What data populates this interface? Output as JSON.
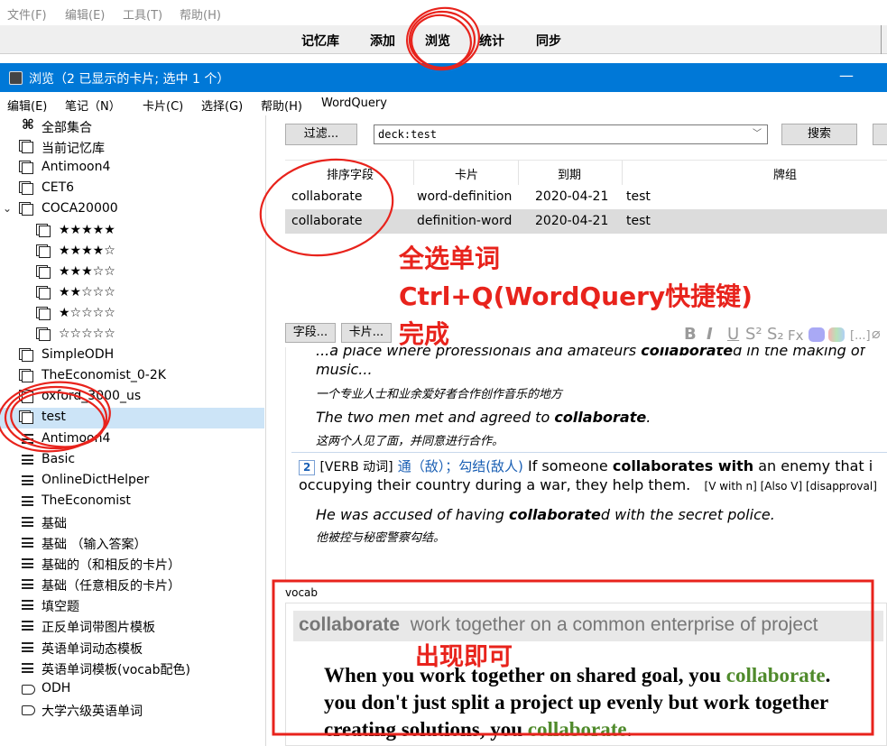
{
  "main_window": {
    "menu": [
      "文件(F)",
      "编辑(E)",
      "工具(T)",
      "帮助(H)"
    ],
    "toolbar": [
      "记忆库",
      "添加",
      "浏览",
      "统计",
      "同步"
    ]
  },
  "browse_window": {
    "title": "浏览（2 已显示的卡片; 选中 1 个）",
    "minimize_glyph": "—",
    "menu": [
      "编辑(E)",
      "笔记（N）",
      "卡片(C)",
      "选择(G)",
      "帮助(H)",
      "WordQuery"
    ]
  },
  "sidebar": {
    "items": [
      {
        "label": "全部集合",
        "icon": "all-collection-icon",
        "indent": 0
      },
      {
        "label": "当前记忆库",
        "icon": "deck-icon",
        "indent": 0
      },
      {
        "label": "Antimoon4",
        "icon": "deck-icon",
        "indent": 0
      },
      {
        "label": "CET6",
        "icon": "deck-icon",
        "indent": 0
      },
      {
        "label": "COCA20000",
        "icon": "deck-icon",
        "indent": 0,
        "expanded": true
      },
      {
        "label": "★★★★★",
        "icon": "deck-icon",
        "indent": 1
      },
      {
        "label": "★★★★☆",
        "icon": "deck-icon",
        "indent": 1
      },
      {
        "label": "★★★☆☆",
        "icon": "deck-icon",
        "indent": 1
      },
      {
        "label": "★★☆☆☆",
        "icon": "deck-icon",
        "indent": 1
      },
      {
        "label": "★☆☆☆☆",
        "icon": "deck-icon",
        "indent": 1
      },
      {
        "label": "☆☆☆☆☆",
        "icon": "deck-icon",
        "indent": 1
      },
      {
        "label": "SimpleODH",
        "icon": "deck-icon",
        "indent": 0
      },
      {
        "label": "TheEconomist_0-2K",
        "icon": "deck-icon",
        "indent": 0
      },
      {
        "label": "oxford_3000_us",
        "icon": "deck-icon",
        "indent": 0
      },
      {
        "label": "test",
        "icon": "deck-icon",
        "indent": 0,
        "selected": true
      },
      {
        "label": "Antimoon4",
        "icon": "note-type-icon",
        "indent": 0
      },
      {
        "label": "Basic",
        "icon": "note-type-icon",
        "indent": 0
      },
      {
        "label": "OnlineDictHelper",
        "icon": "note-type-icon",
        "indent": 0
      },
      {
        "label": "TheEconomist",
        "icon": "note-type-icon",
        "indent": 0
      },
      {
        "label": "基础",
        "icon": "note-type-icon",
        "indent": 0
      },
      {
        "label": "基础 （输入答案）",
        "icon": "note-type-icon",
        "indent": 0
      },
      {
        "label": "基础的（和相反的卡片）",
        "icon": "note-type-icon",
        "indent": 0
      },
      {
        "label": "基础（任意相反的卡片）",
        "icon": "note-type-icon",
        "indent": 0
      },
      {
        "label": "填空题",
        "icon": "note-type-icon",
        "indent": 0
      },
      {
        "label": "正反单词带图片模板",
        "icon": "note-type-icon",
        "indent": 0
      },
      {
        "label": "英语单词动态模板",
        "icon": "note-type-icon",
        "indent": 0
      },
      {
        "label": "英语单词模板(vocab配色)",
        "icon": "note-type-icon",
        "indent": 0
      },
      {
        "label": "ODH",
        "icon": "tag-icon",
        "indent": 0
      },
      {
        "label": "大学六级英语单词",
        "icon": "tag-icon",
        "indent": 0
      }
    ]
  },
  "search": {
    "filter_label": "过滤...",
    "query": "deck:test",
    "search_label": "搜索"
  },
  "table": {
    "columns": [
      "排序字段",
      "卡片",
      "到期",
      "牌组"
    ],
    "rows": [
      {
        "sort": "collaborate",
        "card": "word-definition",
        "due": "2020-04-21",
        "deck": "test",
        "selected": false
      },
      {
        "sort": "collaborate",
        "card": "definition-word",
        "due": "2020-04-21",
        "deck": "test",
        "selected": true
      }
    ]
  },
  "editor": {
    "fields_button": "字段...",
    "cards_button": "卡片...",
    "format_buttons": [
      "B",
      "I",
      "U",
      "S²",
      "S₂",
      "Fx",
      "[...]"
    ],
    "content": {
      "ex1_en_pre": "...a place where professionals and amateurs ",
      "ex1_en_bold": "collaborate",
      "ex1_en_post": "d in the making of",
      "ex1_en_line2": "music...",
      "ex1_zh": "一个专业人士和业余爱好者合作创作音乐的地方",
      "ex2_en_pre": "The two men met and agreed to ",
      "ex2_en_bold": "collaborate",
      "ex2_en_post": ".",
      "ex2_zh": "这两个人见了面，并同意进行合作。",
      "sense_num": "2",
      "sense_pos": "[VERB 动词]",
      "sense_zh": "通（敌）；勾结(敌人)",
      "sense_def_pre": " If someone ",
      "sense_def_bold": "collaborates with",
      "sense_def_post": " an enemy that i",
      "sense_def_line2": "occupying their country during a war, they help them.",
      "sense_gram": "[V with n]  [Also V]  [disapproval]",
      "ex3_en_pre": "He was accused of having ",
      "ex3_en_bold": "collaborate",
      "ex3_en_post": "d with the secret police.",
      "ex3_zh": "他被控与秘密警察勾结。"
    },
    "vocab_label": "vocab",
    "vocab_word": "collaborate",
    "vocab_def": "work together on a common enterprise of project",
    "vocab_ex_line1_pre": "When you work together on shared goal, you ",
    "vocab_ex_line1_hl": "collaborate",
    "vocab_ex_line1_post": ".",
    "vocab_ex_line2": "you don't just split a project up evenly but work together",
    "vocab_ex_line3_pre": "creating solutions, you ",
    "vocab_ex_line3_hl": "collaborate",
    "vocab_ex_line3_post": "."
  },
  "annotations": {
    "step1": "全选单词",
    "step2": "Ctrl+Q(WordQuery快捷键)",
    "step3": "完成",
    "note": "出现即可",
    "color": "#e8231c"
  },
  "colors": {
    "titlebar": "#0078d7",
    "selection": "#cce4f7",
    "accent_blue": "#1a5fb4",
    "vocab_green": "#4f8a2b"
  }
}
